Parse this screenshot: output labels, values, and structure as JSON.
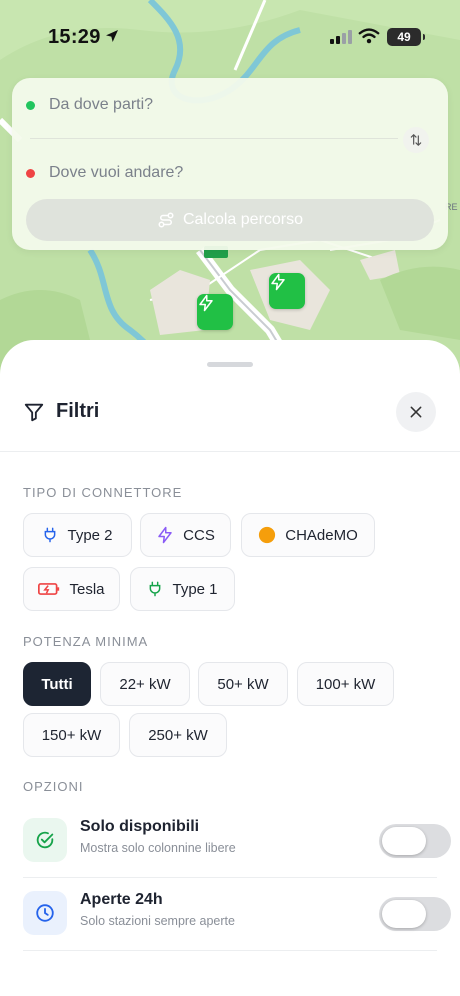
{
  "status_bar": {
    "time": "15:29",
    "battery": "49"
  },
  "route": {
    "from_placeholder": "Da dove parti?",
    "to_placeholder": "Dove vuoi andare?",
    "calculate_label": "Calcola percorso",
    "from_dot_color": "#22c55e",
    "to_dot_color": "#ef4444"
  },
  "map": {
    "marker_color": "#21c045",
    "road_sign": "RE"
  },
  "filters": {
    "title": "Filtri",
    "connector_section": "TIPO DI CONNETTORE",
    "connectors": [
      {
        "label": "Type 2",
        "icon": "plug-icon",
        "color": "#2563eb"
      },
      {
        "label": "CCS",
        "icon": "bolt-icon",
        "color": "#8b5cf6"
      },
      {
        "label": "CHAdeMO",
        "icon": "circle-icon",
        "color": "#f59e0b"
      },
      {
        "label": "Tesla",
        "icon": "battery-charging-icon",
        "color": "#ef4444"
      },
      {
        "label": "Type 1",
        "icon": "plug-icon",
        "color": "#16a34a"
      }
    ],
    "power_section": "POTENZA MINIMA",
    "power_options": [
      "Tutti",
      "22+ kW",
      "50+ kW",
      "100+ kW",
      "150+ kW",
      "250+ kW"
    ],
    "power_selected": "Tutti",
    "options_section": "OPZIONI",
    "options": [
      {
        "title": "Solo disponibili",
        "subtitle": "Mostra solo colonnine libere",
        "icon": "check-circle-icon",
        "enabled": false
      },
      {
        "title": "Aperte 24h",
        "subtitle": "Solo stazioni sempre aperte",
        "icon": "clock-icon",
        "enabled": false
      }
    ]
  }
}
